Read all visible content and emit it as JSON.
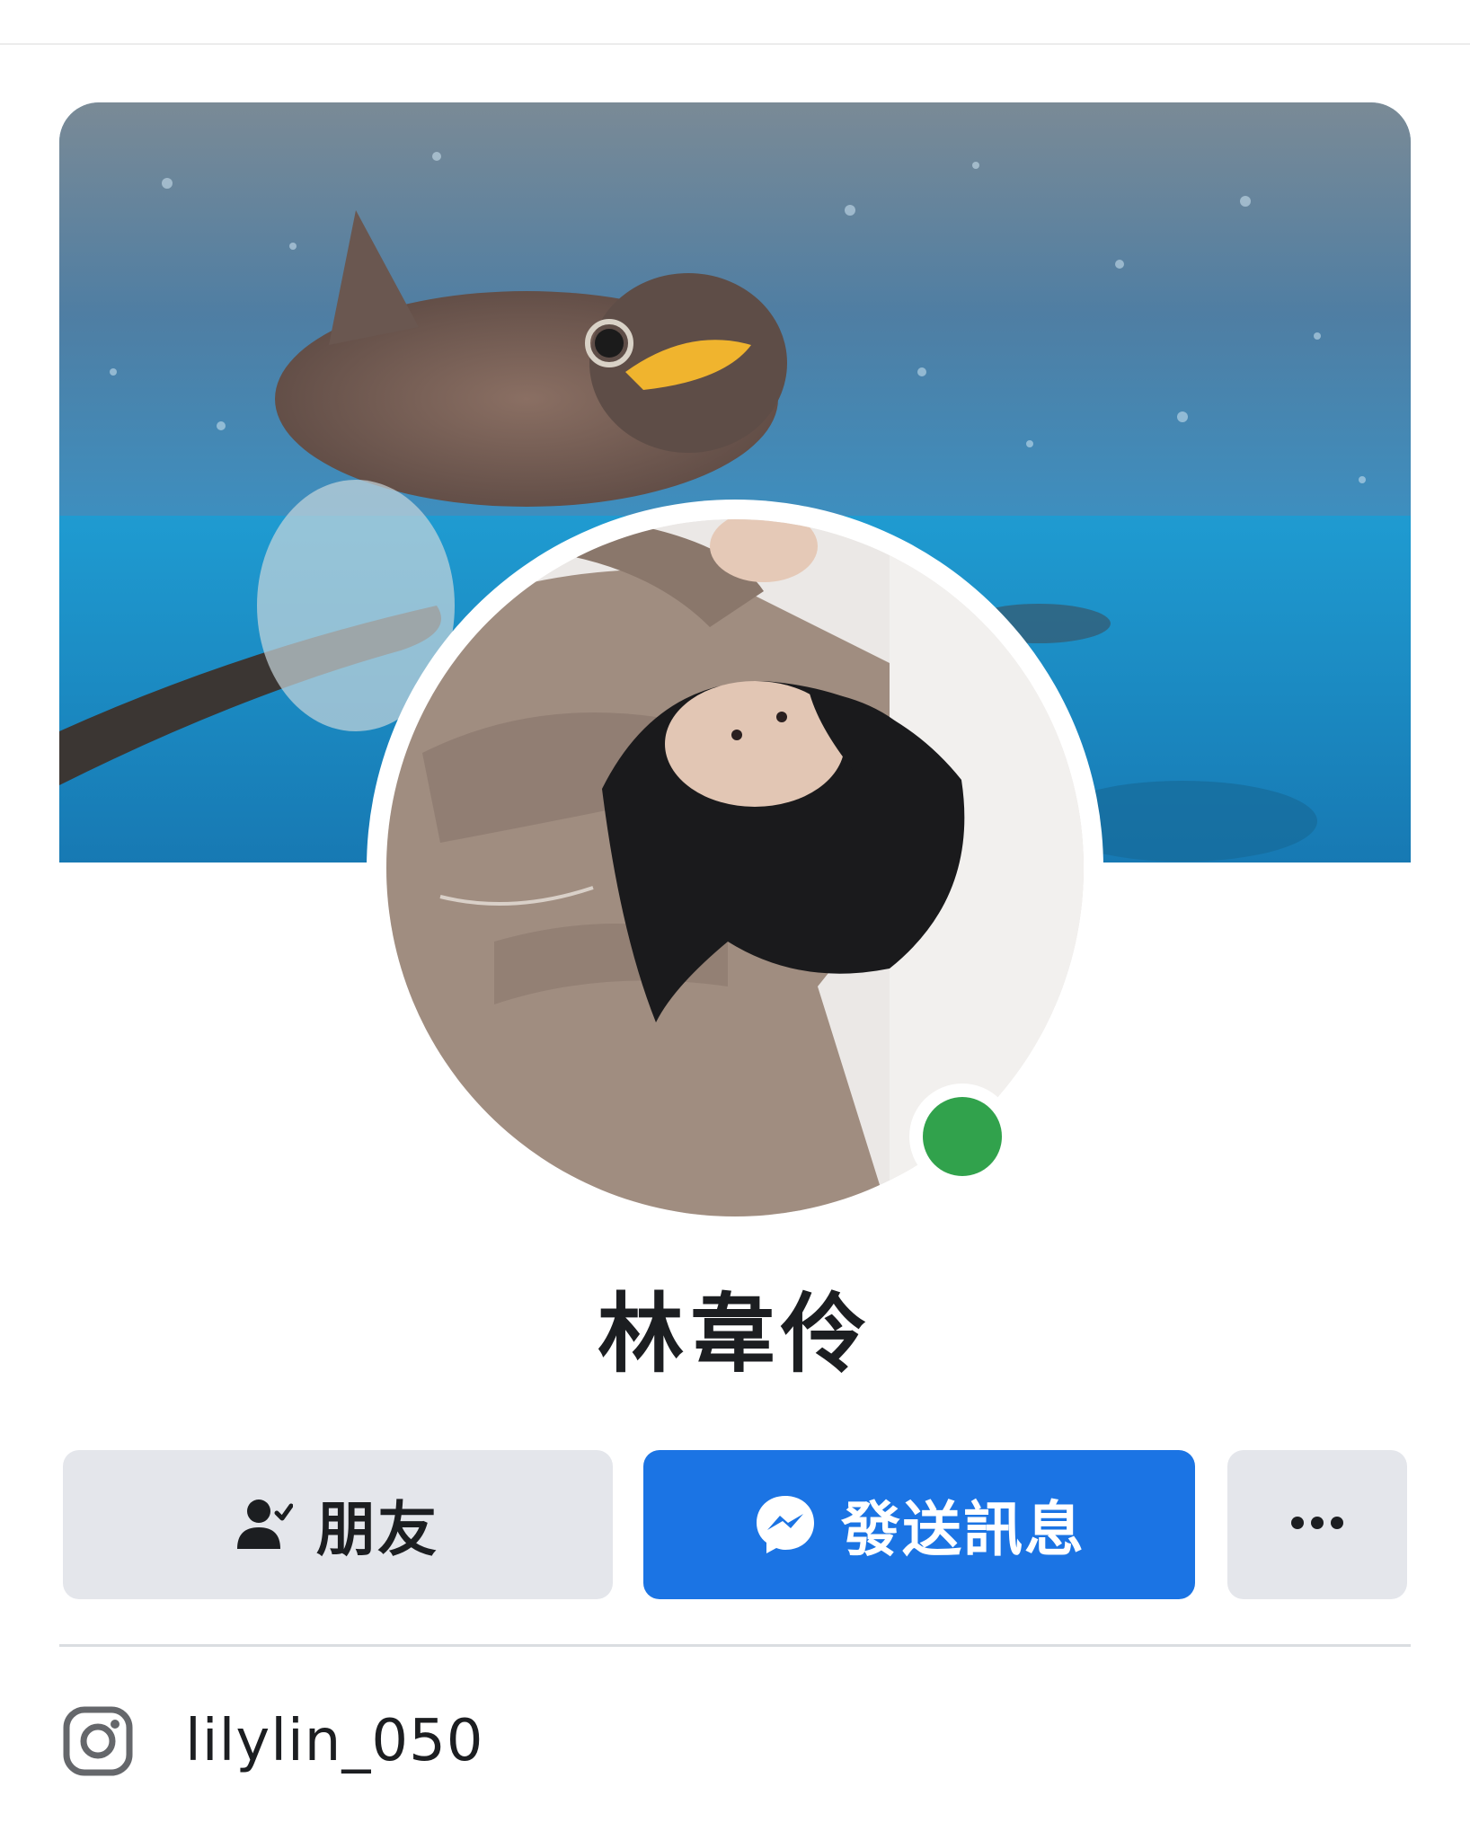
{
  "profile": {
    "name": "林韋伶",
    "online": true
  },
  "actions": {
    "friends_label": "朋友",
    "message_label": "發送訊息",
    "more_icon": "ellipsis-icon"
  },
  "links": {
    "instagram_handle": "lilylin_050",
    "instagram_icon": "instagram-icon"
  },
  "colors": {
    "message_button": "#1b74e4",
    "secondary_button": "#e4e6eb",
    "online_dot": "#31a24c",
    "text": "#1c1e21"
  }
}
